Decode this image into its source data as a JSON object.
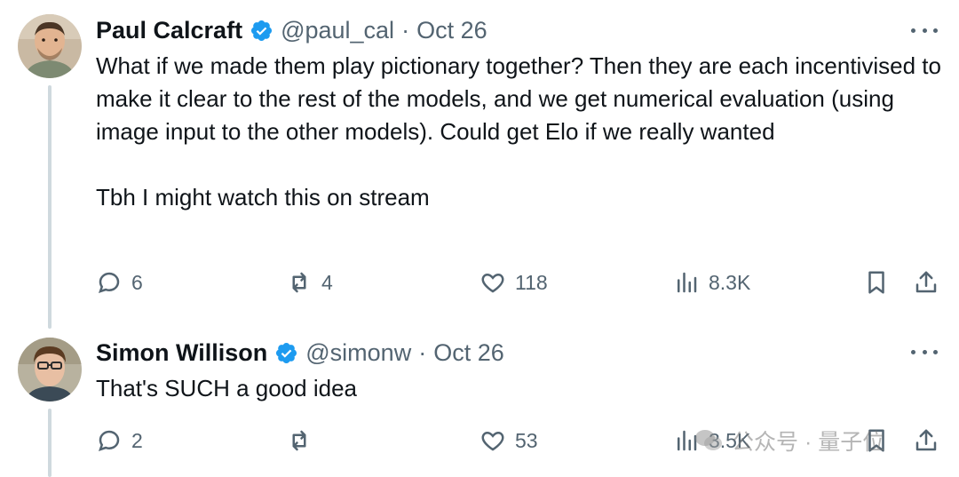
{
  "tweets": [
    {
      "author": {
        "name": "Paul Calcraft",
        "handle": "@paul_cal",
        "separator": "·",
        "date": "Oct 26",
        "verified": true
      },
      "body": [
        "What if we made them play pictionary together? Then they are each incentivised to make it clear to the rest of the models, and we get numerical evaluation (using image input to the other models). Could get Elo if we really wanted",
        "Tbh I might watch this on stream"
      ],
      "actions": {
        "replies": "6",
        "reposts": "4",
        "likes": "118",
        "views": "8.3K"
      }
    },
    {
      "author": {
        "name": "Simon Willison",
        "handle": "@simonw",
        "separator": "·",
        "date": "Oct 26",
        "verified": true
      },
      "body": [
        "That's SUCH a good idea"
      ],
      "actions": {
        "replies": "2",
        "reposts": "",
        "likes": "53",
        "views": "3.5K"
      }
    }
  ],
  "watermark": {
    "text": "公众号 · 量子位"
  },
  "colors": {
    "text_primary": "#0f1419",
    "text_secondary": "#536471",
    "verified_blue": "#1d9bf0",
    "thread_line": "#cfd9de"
  }
}
